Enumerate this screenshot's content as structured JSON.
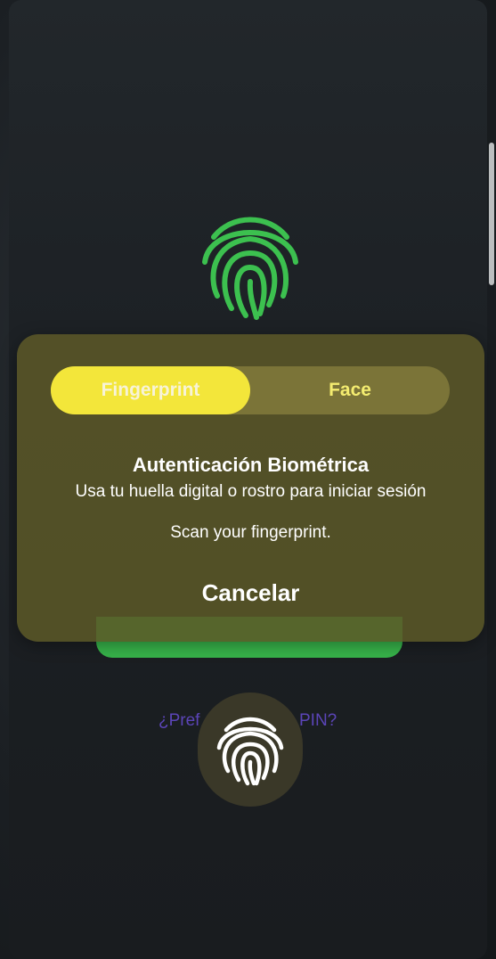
{
  "background": {
    "pin_link_left": "¿Pref",
    "pin_link_right": "PIN?",
    "fingerprint_color": "#3cc04f",
    "button_color": "#37b34a"
  },
  "dialog": {
    "tabs": [
      {
        "label": "Fingerprint",
        "selected": true
      },
      {
        "label": "Face",
        "selected": false
      }
    ],
    "title": "Autenticación Biométrica",
    "subtitle": "Usa tu huella digital o rostro para iniciar sesión",
    "status": "Scan your fingerprint.",
    "cancel_label": "Cancelar",
    "accent_color": "#f3e63a"
  },
  "sensor": {
    "icon": "fingerprint-icon"
  }
}
